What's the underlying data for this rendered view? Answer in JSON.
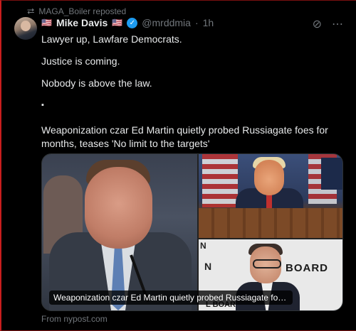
{
  "repost": {
    "label": "MAGA_Boiler reposted"
  },
  "author": {
    "name": "Mike Davis",
    "flag": "🇺🇸",
    "handle": "@mrddmia",
    "separator": "·",
    "time": "1h"
  },
  "post": {
    "lines": [
      "Lawyer up, Lawfare Democrats.",
      "Justice is coming.",
      "Nobody is above the law.",
      "▪",
      "Weaponization czar Ed Martin quietly probed Russiagate foes for months, teases 'No limit to the targets'"
    ]
  },
  "media": {
    "caption": "Weaponization czar Ed Martin quietly probed Russiagate foes for...",
    "sign_n_top": "N",
    "sign_n_mid": "N",
    "sign_board": "BOARD",
    "sign_board_bottom": "L BOARD",
    "source": "From nypost.com"
  },
  "icons": {
    "repost": "repost-icon",
    "verified": "verified-badge-icon",
    "grok": "grok-icon",
    "more": "more-icon"
  }
}
